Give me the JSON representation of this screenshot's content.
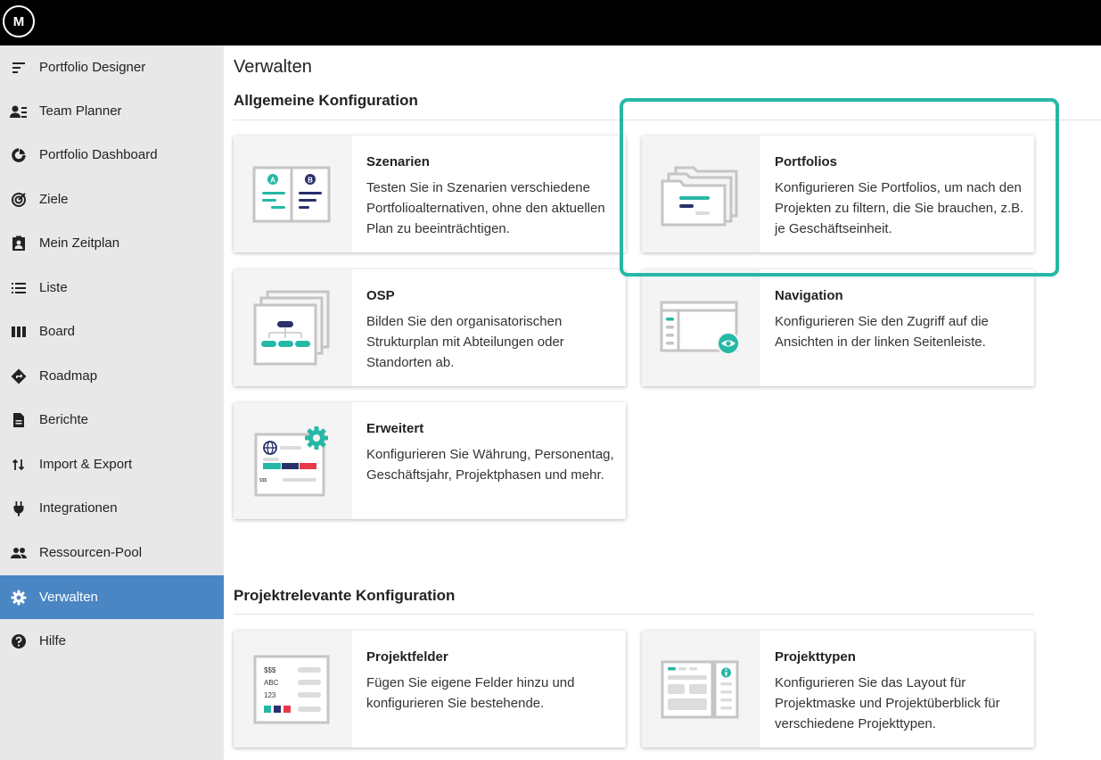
{
  "app": {
    "logo_text": "M"
  },
  "sidebar": {
    "items": [
      {
        "label": "Portfolio Designer",
        "icon": "portfolio-designer-icon",
        "active": false
      },
      {
        "label": "Team Planner",
        "icon": "team-planner-icon",
        "active": false
      },
      {
        "label": "Portfolio Dashboard",
        "icon": "dashboard-icon",
        "active": false
      },
      {
        "label": "Ziele",
        "icon": "target-icon",
        "active": false
      },
      {
        "label": "Mein Zeitplan",
        "icon": "schedule-icon",
        "active": false
      },
      {
        "label": "Liste",
        "icon": "list-icon",
        "active": false
      },
      {
        "label": "Board",
        "icon": "board-icon",
        "active": false
      },
      {
        "label": "Roadmap",
        "icon": "roadmap-icon",
        "active": false
      },
      {
        "label": "Berichte",
        "icon": "report-icon",
        "active": false
      },
      {
        "label": "Import & Export",
        "icon": "import-export-icon",
        "active": false
      },
      {
        "label": "Integrationen",
        "icon": "plug-icon",
        "active": false
      },
      {
        "label": "Ressourcen-Pool",
        "icon": "people-icon",
        "active": false
      },
      {
        "label": "Verwalten",
        "icon": "gear-icon",
        "active": true
      },
      {
        "label": "Hilfe",
        "icon": "help-icon",
        "active": false
      }
    ]
  },
  "main": {
    "title": "Verwalten",
    "general_section": {
      "title": "Allgemeine Konfiguration",
      "cards": [
        {
          "title": "Szenarien",
          "description": "Testen Sie in Szenarien verschiedene Portfolioalternativen, ohne den aktuellen Plan zu beeinträchtigen.",
          "icon": "scenarios-icon"
        },
        {
          "title": "Portfolios",
          "description": "Konfigurieren Sie Portfolios, um nach den Projekten zu filtern, die Sie brauchen, z.B. je Geschäftseinheit.",
          "icon": "folders-icon"
        },
        {
          "title": "OSP",
          "description": "Bilden Sie den organisatorischen Strukturplan mit Abteilungen oder Standorten ab.",
          "icon": "org-chart-icon"
        },
        {
          "title": "Navigation",
          "description": "Konfigurieren Sie den Zugriff auf die Ansichten in der linken Seitenleiste.",
          "icon": "navigation-icon"
        },
        {
          "title": "Erweitert",
          "description": "Konfigurieren Sie Währung, Personentag, Geschäftsjahr, Projektphasen und mehr.",
          "icon": "advanced-settings-icon"
        }
      ]
    },
    "project_section": {
      "title": "Projektrelevante Konfiguration",
      "cards": [
        {
          "title": "Projektfelder",
          "description": "Fügen Sie eigene Felder hinzu und konfigurieren Sie bestehende.",
          "icon": "fields-icon"
        },
        {
          "title": "Projekttypen",
          "description": "Konfigurieren Sie das Layout für Projektmaske und Projektüberblick für verschiedene Projekttypen.",
          "icon": "project-types-icon"
        }
      ]
    },
    "thumb_labels": {
      "scenario_a": "A",
      "scenario_b": "B",
      "currency_small": "$$$",
      "fields_currency": "$$$",
      "fields_text": "ABC",
      "fields_number": "123"
    }
  },
  "colors": {
    "accent_teal": "#26b8a6",
    "navy": "#2b2f6b",
    "red": "#e8394a",
    "active_blue": "#4a86c4",
    "highlight": "#26b8a6"
  }
}
